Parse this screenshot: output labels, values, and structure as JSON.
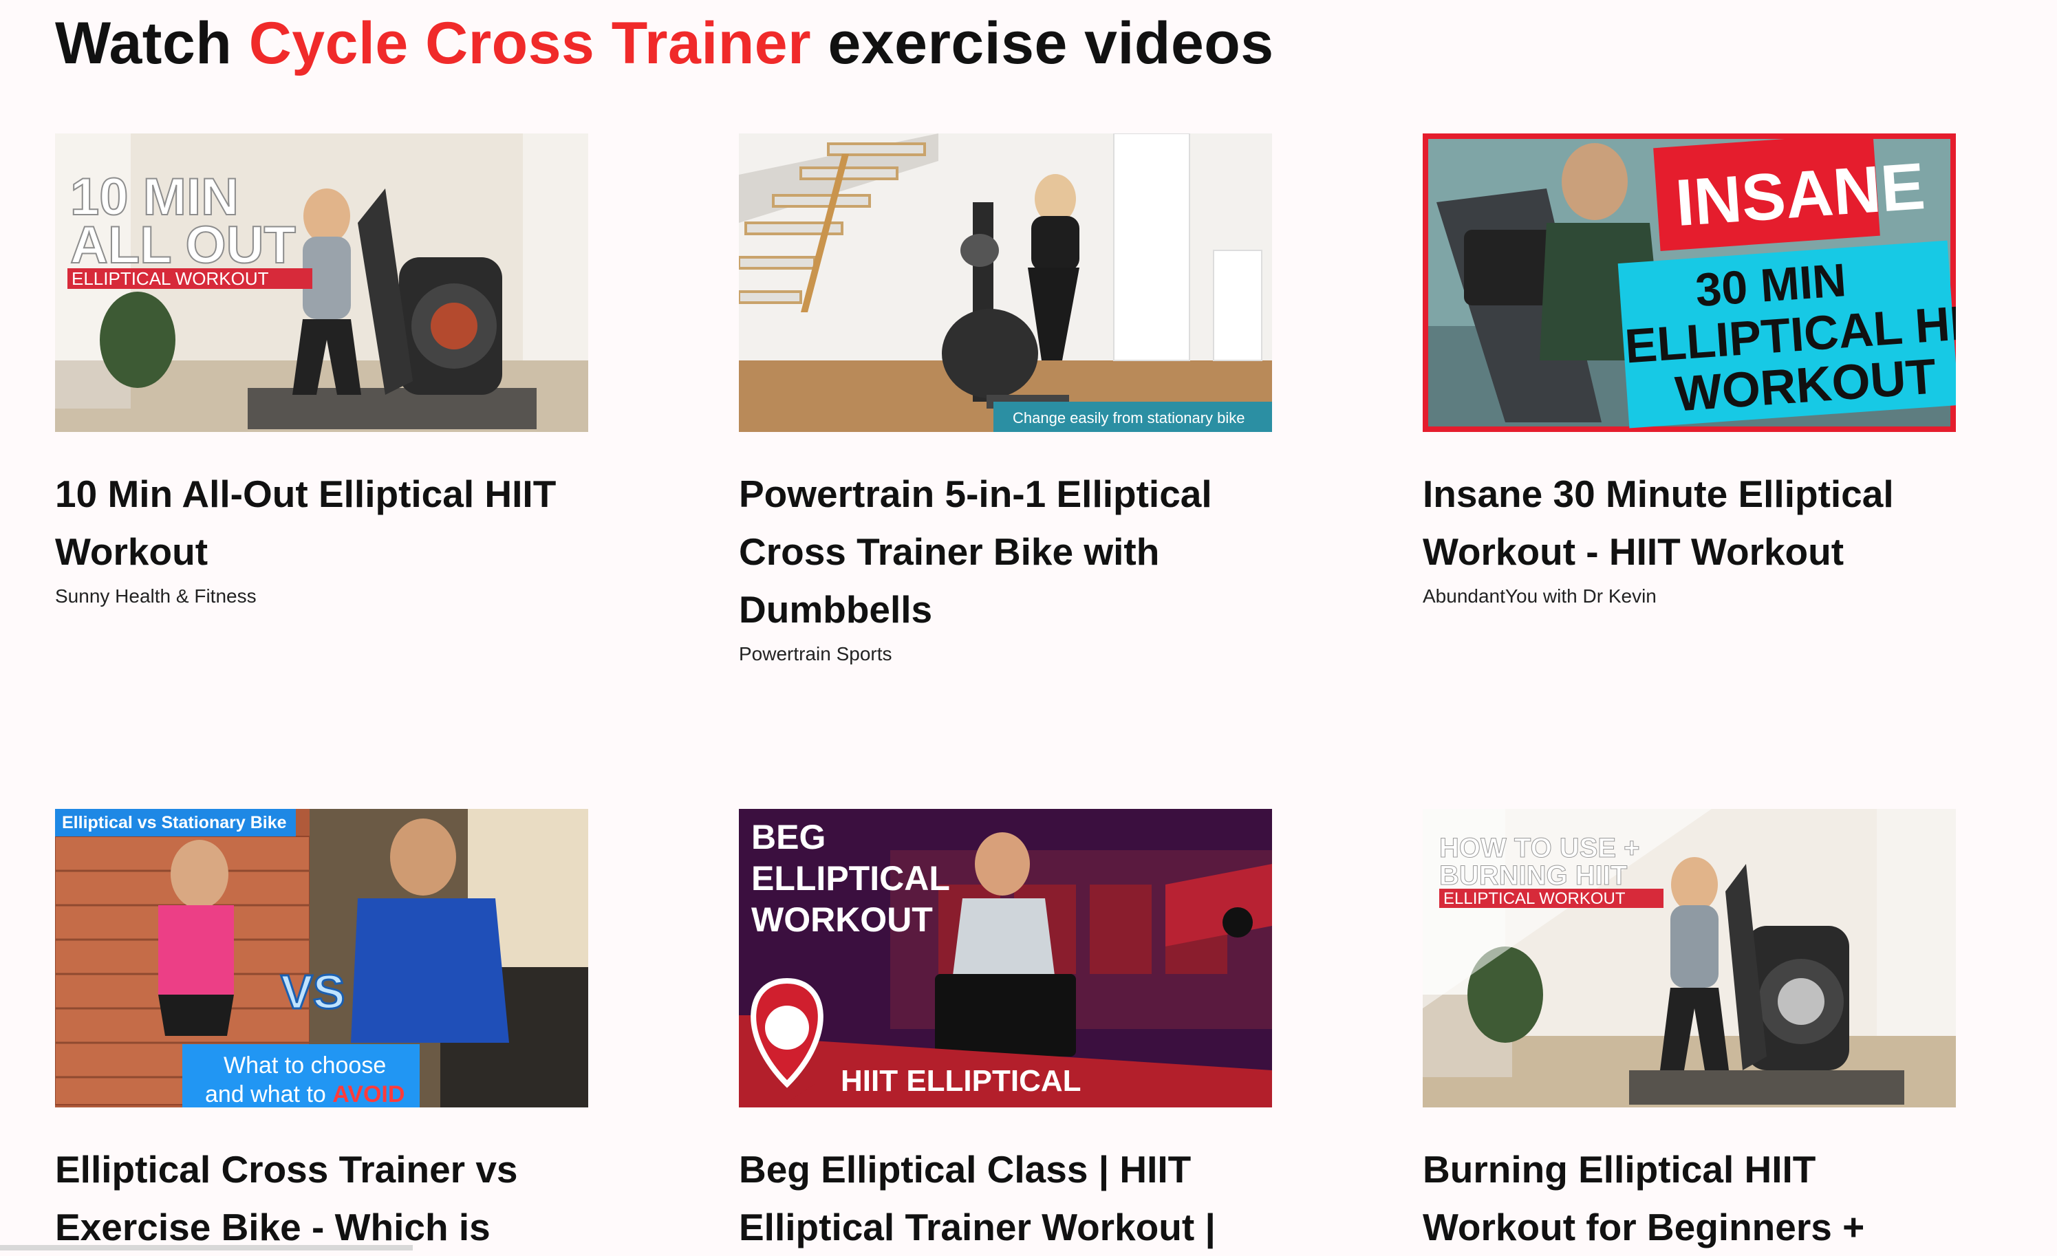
{
  "header": {
    "title_prefix": "Watch ",
    "title_accent": "Cycle Cross Trainer",
    "title_suffix": " exercise videos",
    "accent_color": "#f02a2a"
  },
  "videos": [
    {
      "title": "10 Min All-Out Elliptical HIIT Workout",
      "channel": "Sunny Health & Fitness",
      "thumb_text": [
        "10 MIN",
        "ALL OUT",
        "ELLIPTICAL WORKOUT"
      ]
    },
    {
      "title": "Powertrain 5-in-1 Elliptical Cross Trainer Bike with Dumbbells",
      "channel": "Powertrain Sports",
      "thumb_text": [
        "Change easily from stationary bike"
      ]
    },
    {
      "title": "Insane 30 Minute Elliptical Workout - HIIT Workout",
      "channel": "AbundantYou with Dr Kevin",
      "thumb_text": [
        "INSANE",
        "30 MIN",
        "ELLIPTICAL HIIT",
        "WORKOUT"
      ]
    },
    {
      "title": "Elliptical Cross Trainer vs Exercise Bike - Which is",
      "channel": "",
      "thumb_text": [
        "Elliptical vs Stationary Bike",
        "VS",
        "What to choose",
        "and what to ",
        "AVOID"
      ]
    },
    {
      "title": "Beg Elliptical Class | HIIT Elliptical Trainer Workout |",
      "channel": "",
      "thumb_text": [
        "BEG",
        "ELLIPTICAL",
        "WORKOUT",
        "HIIT ELLIPTICAL"
      ]
    },
    {
      "title": "Burning Elliptical HIIT Workout for Beginners +",
      "channel": "",
      "thumb_text": [
        "HOW TO USE +",
        "BURNING HIIT",
        "ELLIPTICAL WORKOUT"
      ]
    }
  ]
}
